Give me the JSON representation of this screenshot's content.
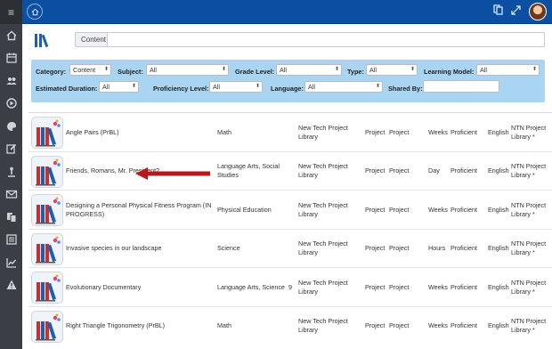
{
  "topbar": {
    "home_icon": "home-icon",
    "actions": [
      "copy-icon",
      "expand-icon",
      "user-avatar"
    ]
  },
  "sidebar": {
    "toggle_icon": "menu-toggle-icon",
    "items": [
      {
        "icon": "home-icon"
      },
      {
        "icon": "calendar-icon"
      },
      {
        "icon": "people-icon"
      },
      {
        "icon": "play-circle-icon"
      },
      {
        "icon": "palette-icon"
      },
      {
        "icon": "edit-icon"
      },
      {
        "icon": "upload-icon"
      },
      {
        "icon": "mail-icon"
      },
      {
        "icon": "documents-icon"
      },
      {
        "icon": "list-icon"
      },
      {
        "icon": "chart-icon"
      },
      {
        "icon": "warning-icon"
      }
    ]
  },
  "search": {
    "tab_label": "Content",
    "query": ""
  },
  "filters": {
    "category_label": "Category:",
    "category_value": "Content",
    "subject_label": "Subject:",
    "subject_value": "All",
    "grade_label": "Grade Level:",
    "grade_value": "All",
    "type_label": "Type:",
    "type_value": "All",
    "model_label": "Learning Model:",
    "model_value": "All",
    "duration_label": "Estimated Duration:",
    "duration_value": "All",
    "proficiency_label": "Proficiency Level:",
    "proficiency_value": "All",
    "language_label": "Language:",
    "language_value": "All",
    "shared_label": "Shared By:",
    "shared_value": ""
  },
  "results": [
    {
      "title": "Angle Pairs (PrBL)",
      "subject": "Math",
      "grade": "",
      "library": "New Tech Project Library",
      "type": "Project",
      "model": "Project",
      "duration": "Weeks",
      "proficiency": "Proficient",
      "language": "English",
      "shared": "NTN Project Library *"
    },
    {
      "title": "Friends, Romans, Mr. President?",
      "subject": "Language Arts, Social Studies",
      "grade": "",
      "library": "New Tech Project Library",
      "type": "Project",
      "model": "Project",
      "duration": "Day",
      "proficiency": "Proficient",
      "language": "English",
      "shared": "NTN Project Library *"
    },
    {
      "title": "Designing a Personal Physical Fitness Program (IN PROGRESS)",
      "subject": "Physical Education",
      "grade": "",
      "library": "New Tech Project Library",
      "type": "Project",
      "model": "Project",
      "duration": "Weeks",
      "proficiency": "Proficient",
      "language": "English",
      "shared": "NTN Project Library *"
    },
    {
      "title": "Invasive species in our landscape",
      "subject": "Science",
      "grade": "",
      "library": "New Tech Project Library",
      "type": "Project",
      "model": "Project",
      "duration": "Hours",
      "proficiency": "Proficient",
      "language": "English",
      "shared": "NTN Project Library *"
    },
    {
      "title": "Evolutionary Documentary",
      "subject": "Language Arts, Science",
      "grade": "9",
      "library": "New Tech Project Library",
      "type": "Project",
      "model": "Project",
      "duration": "Weeks",
      "proficiency": "Proficient",
      "language": "English",
      "shared": "NTN Project Library *"
    },
    {
      "title": "Right Triangle Trigonometry (PrBL)",
      "subject": "Math",
      "grade": "",
      "library": "New Tech Project Library",
      "type": "Project",
      "model": "Project",
      "duration": "Weeks",
      "proficiency": "Proficient",
      "language": "English",
      "shared": "NTN Project Library *"
    }
  ],
  "colors": {
    "topbar": "#0b4fa3",
    "sidebar": "#3b3f45",
    "filter_panel": "#a9d5f3",
    "annotation_arrow": "#b5191b"
  }
}
